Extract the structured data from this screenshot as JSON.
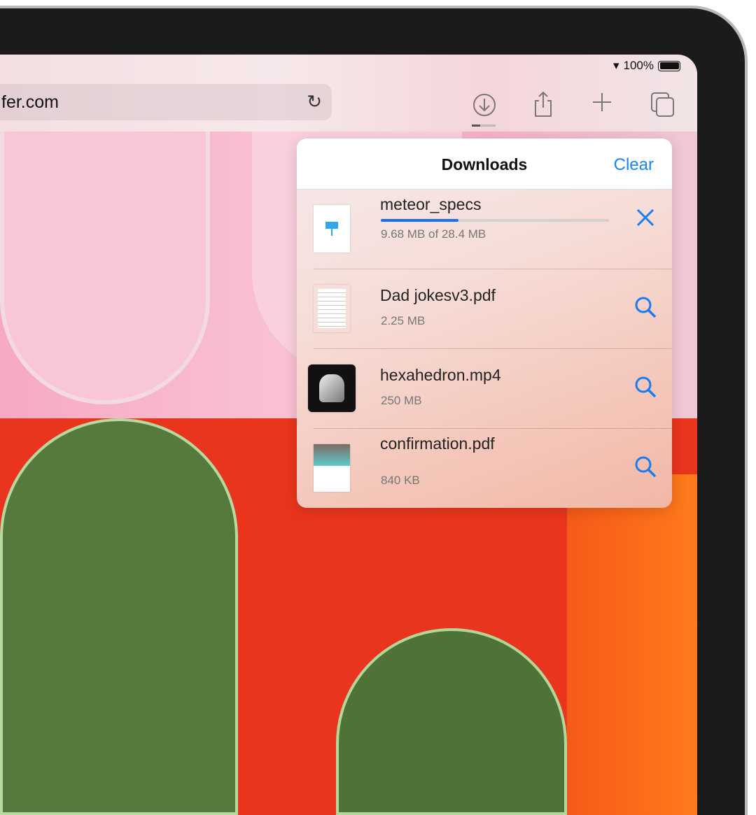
{
  "status": {
    "battery_text": "100%",
    "battery_level": 1.0
  },
  "toolbar": {
    "url": "fer.com"
  },
  "downloads": {
    "title": "Downloads",
    "clear_label": "Clear",
    "items": [
      {
        "name": "meteor_specs",
        "size": "9.68 MB of 28.4 MB",
        "progress": 0.34,
        "action": "cancel-icon",
        "thumb": "keynote"
      },
      {
        "name": "Dad jokesv3.pdf",
        "size": "2.25 MB",
        "action": "magnifier-icon",
        "thumb": "pdf"
      },
      {
        "name": "hexahedron.mp4",
        "size": "250 MB",
        "action": "magnifier-icon",
        "thumb": "video"
      },
      {
        "name": "confirmation.pdf",
        "size": "840 KB",
        "action": "magnifier-icon",
        "thumb": "pdf-image"
      }
    ]
  },
  "colors": {
    "accent": "#1a84f0"
  }
}
